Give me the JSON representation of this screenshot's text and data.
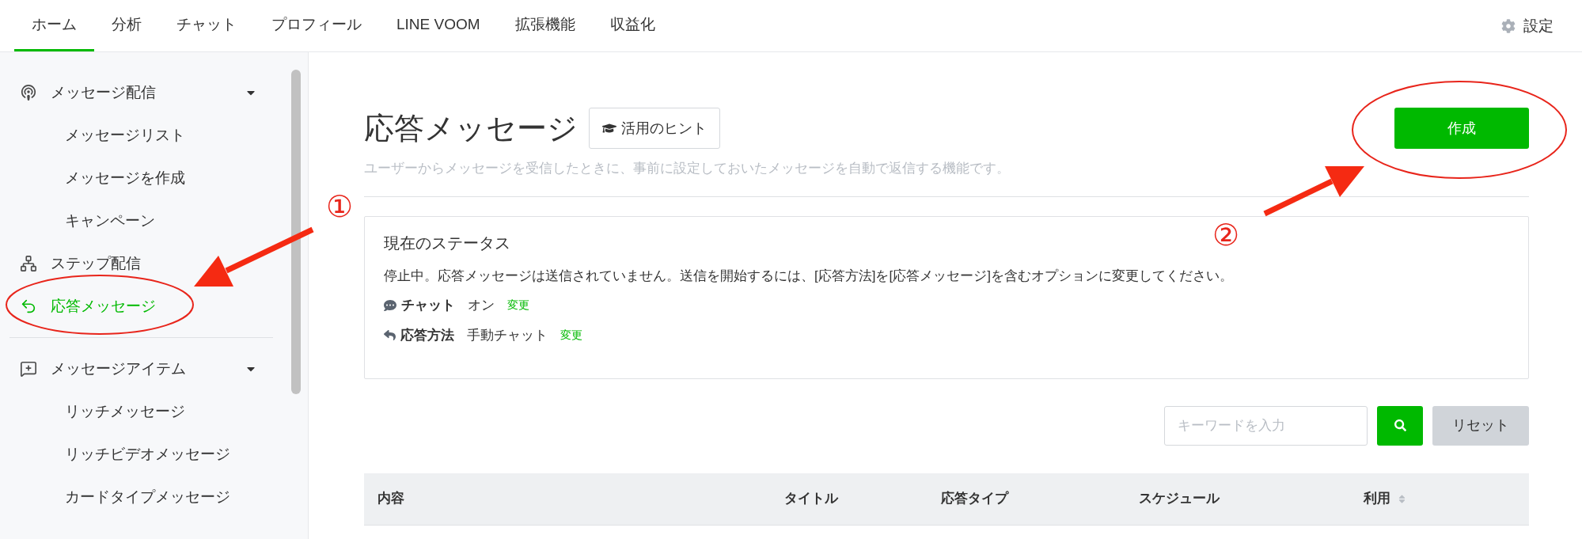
{
  "nav": {
    "tabs": [
      {
        "label": "ホーム",
        "selected": true
      },
      {
        "label": "分析",
        "selected": false
      },
      {
        "label": "チャット",
        "selected": false
      },
      {
        "label": "プロフィール",
        "selected": false
      },
      {
        "label": "LINE VOOM",
        "selected": false
      },
      {
        "label": "拡張機能",
        "selected": false
      },
      {
        "label": "収益化",
        "selected": false
      }
    ],
    "settings": "設定"
  },
  "sidebar": {
    "sections": [
      [
        {
          "label": "メッセージ配信",
          "expanded": true,
          "selected": false,
          "children": [
            {
              "label": "メッセージリスト",
              "selected": false
            },
            {
              "label": "メッセージを作成",
              "selected": false
            },
            {
              "label": "キャンペーン",
              "selected": false
            }
          ]
        },
        {
          "label": "ステップ配信",
          "selected": false
        },
        {
          "label": "応答メッセージ",
          "selected": true
        }
      ],
      [
        {
          "label": "メッセージアイテム",
          "expanded": true,
          "selected": false,
          "children": [
            {
              "label": "リッチメッセージ",
              "selected": false
            },
            {
              "label": "リッチビデオメッセージ",
              "selected": false
            },
            {
              "label": "カードタイプメッセージ",
              "selected": false
            }
          ]
        }
      ]
    ]
  },
  "page": {
    "title": "応答メッセージ",
    "hint_button": "活用のヒント",
    "create_button": "作成",
    "description": "ユーザーからメッセージを受信したときに、事前に設定しておいたメッセージを自動で返信する機能です。"
  },
  "status": {
    "heading": "現在のステータス",
    "message": "停止中。応答メッセージは送信されていません。送信を開始するには、[応答方法]を[応答メッセージ]を含むオプションに変更してください。",
    "rows": [
      {
        "label": "チャット",
        "value": "オン",
        "link": "変更"
      },
      {
        "label": "応答方法",
        "value": "手動チャット",
        "link": "変更"
      }
    ]
  },
  "search": {
    "placeholder": "キーワードを入力",
    "reset": "リセット"
  },
  "table": {
    "columns": [
      {
        "label": "内容",
        "sortable": false
      },
      {
        "label": "タイトル",
        "sortable": false
      },
      {
        "label": "応答タイプ",
        "sortable": false
      },
      {
        "label": "スケジュール",
        "sortable": false
      },
      {
        "label": "利用",
        "sortable": true
      }
    ]
  },
  "annotations": [
    "①",
    "②"
  ]
}
